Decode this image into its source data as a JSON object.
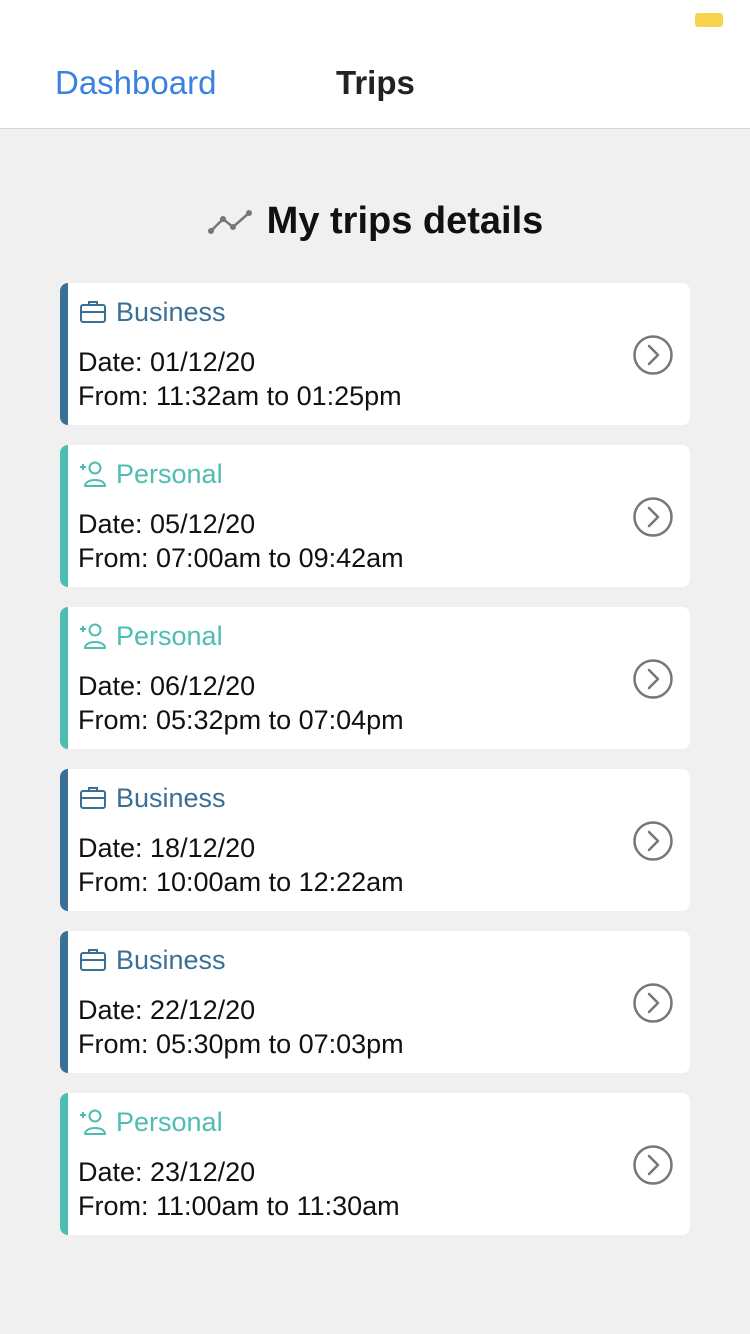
{
  "nav": {
    "dashboard_label": "Dashboard",
    "title": "Trips"
  },
  "page": {
    "heading": "My trips details"
  },
  "colors": {
    "business": "#3a6f96",
    "personal": "#4dbdb0",
    "link": "#3b82e0"
  },
  "trips": [
    {
      "type": "Business",
      "icon": "briefcase-icon",
      "date": "Date: 01/12/20",
      "time": "From: 11:32am to 01:25pm"
    },
    {
      "type": "Personal",
      "icon": "add-user-icon",
      "date": "Date: 05/12/20",
      "time": "From: 07:00am to 09:42am"
    },
    {
      "type": "Personal",
      "icon": "add-user-icon",
      "date": "Date: 06/12/20",
      "time": "From: 05:32pm to 07:04pm"
    },
    {
      "type": "Business",
      "icon": "briefcase-icon",
      "date": "Date: 18/12/20",
      "time": "From: 10:00am to 12:22am"
    },
    {
      "type": "Business",
      "icon": "briefcase-icon",
      "date": "Date: 22/12/20",
      "time": "From: 05:30pm to 07:03pm"
    },
    {
      "type": "Personal",
      "icon": "add-user-icon",
      "date": "Date: 23/12/20",
      "time": "From: 11:00am to 11:30am"
    }
  ]
}
